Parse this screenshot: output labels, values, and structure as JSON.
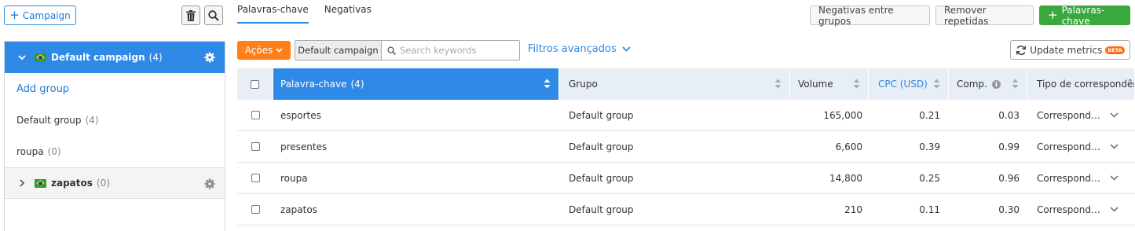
{
  "left": {
    "campaign_button": "Campaign",
    "campaigns": [
      {
        "name": "Default campaign",
        "count": "(4)"
      },
      {
        "name": "zapatos",
        "count": "(0)"
      }
    ],
    "add_group": "Add group",
    "groups": [
      {
        "name": "Default group",
        "count": "(4)"
      },
      {
        "name": "roupa",
        "count": "(0)"
      }
    ]
  },
  "tabs": [
    {
      "label": "Palavras-chave",
      "active": true
    },
    {
      "label": "Negativas",
      "active": false
    }
  ],
  "toolbar": {
    "negativas_entre_grupos": "Negativas entre grupos",
    "remover_repetidas": "Remover repetidas",
    "add_keywords": "Palavras-chave",
    "acoes": "Ações",
    "campaign_chip": "Default campaign",
    "search_placeholder": "Search keywords",
    "filtros": "Filtros avançados",
    "update_metrics": "Update metrics",
    "beta": "BETA"
  },
  "table": {
    "headers": {
      "keyword": "Palavra-chave",
      "keyword_count": "(4)",
      "group": "Grupo",
      "volume": "Volume",
      "cpc": "CPC (USD)",
      "comp": "Comp.",
      "match": "Tipo de correspondência"
    },
    "rows": [
      {
        "keyword": "esportes",
        "group": "Default group",
        "volume": "165,000",
        "cpc": "0.21",
        "comp": "0.03",
        "match": "Correspond…"
      },
      {
        "keyword": "presentes",
        "group": "Default group",
        "volume": "6,600",
        "cpc": "0.39",
        "comp": "0.99",
        "match": "Correspond…"
      },
      {
        "keyword": "roupa",
        "group": "Default group",
        "volume": "14,800",
        "cpc": "0.25",
        "comp": "0.96",
        "match": "Correspond…"
      },
      {
        "keyword": "zapatos",
        "group": "Default group",
        "volume": "210",
        "cpc": "0.11",
        "comp": "0.30",
        "match": "Correspond…"
      }
    ]
  },
  "colors": {
    "accent": "#2e8ae6",
    "orange": "#ff7f1a",
    "green": "#3aa83d"
  }
}
